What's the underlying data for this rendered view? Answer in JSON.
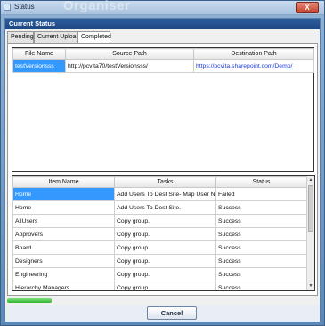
{
  "window": {
    "title": "Status",
    "background_title": "Organiser",
    "close_label": "X"
  },
  "section": {
    "title": "Current Status"
  },
  "tabs": [
    {
      "label": "Pending"
    },
    {
      "label": "Current Upload"
    },
    {
      "label": "Completed"
    }
  ],
  "files": {
    "columns": [
      "File Name",
      "Source Path",
      "Destination Path"
    ],
    "rows": [
      {
        "file_name": "testVersionsss",
        "source_path": "http://pcvita70/testVersionsss/",
        "destination_path": "https://pcvita.sharepoint.com/Demo/"
      }
    ]
  },
  "items": {
    "columns": [
      "Item Name",
      "Tasks",
      "Status"
    ],
    "rows": [
      {
        "name": "Home",
        "task": "Add Users To Dest Site- Map User Na...",
        "status": "Failed"
      },
      {
        "name": "Home",
        "task": "Add Users To Dest Site.",
        "status": "Success"
      },
      {
        "name": "AllUsers",
        "task": "Copy group.",
        "status": "Success"
      },
      {
        "name": "Approvers",
        "task": "Copy group.",
        "status": "Success"
      },
      {
        "name": "Board",
        "task": "Copy group.",
        "status": "Success"
      },
      {
        "name": "Designers",
        "task": "Copy group.",
        "status": "Success"
      },
      {
        "name": "Engineering",
        "task": "Copy group.",
        "status": "Success"
      },
      {
        "name": "Hierarchy Managers",
        "task": "Copy group.",
        "status": "Success"
      }
    ]
  },
  "scrollbar": {
    "up_glyph": "▲",
    "down_glyph": "▼"
  },
  "footer": {
    "cancel_label": "Cancel"
  }
}
